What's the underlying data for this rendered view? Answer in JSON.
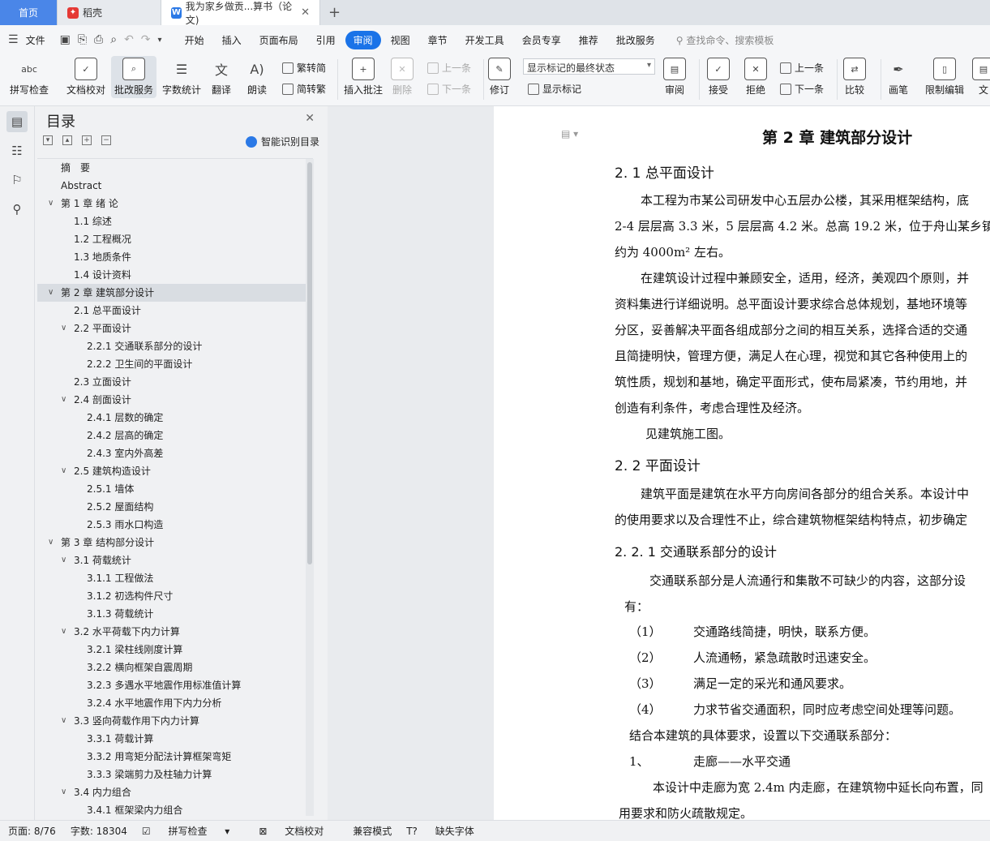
{
  "tabs": {
    "home": "首页",
    "daoke": "稻壳",
    "doc": "我为家乡做贡...算书（论文)",
    "add": "+"
  },
  "menu": {
    "file": "文件",
    "items": [
      "开始",
      "插入",
      "页面布局",
      "引用",
      "审阅",
      "视图",
      "章节",
      "开发工具",
      "会员专享",
      "推荐",
      "批改服务"
    ],
    "active": "审阅",
    "search": "查找命令、搜索模板"
  },
  "ribbon": {
    "spell": "拼写检查",
    "doccheck": "文档校对",
    "correct": "批改服务",
    "wordcount": "字数统计",
    "translate": "翻译",
    "read": "朗读",
    "trad": "繁转简",
    "simp": "简转繁",
    "insert_comment": "插入批注",
    "delete": "删除",
    "prev": "上一条",
    "next": "下一条",
    "track": "修订",
    "mark_state": "显示标记的最终状态",
    "show_marks": "显示标记",
    "review": "审阅",
    "accept": "接受",
    "reject": "拒绝",
    "prev2": "上一条",
    "next2": "下一条",
    "compare": "比较",
    "pen": "画笔",
    "restrict": "限制编辑",
    "doc_more": "文"
  },
  "toc": {
    "title": "目录",
    "smart": "智能识别目录",
    "items": [
      {
        "text": "摘　要",
        "level": 0,
        "chev": false
      },
      {
        "text": "Abstract",
        "level": 0,
        "chev": false
      },
      {
        "text": "第 1 章  绪  论",
        "level": 0,
        "chev": true
      },
      {
        "text": "1.1 综述",
        "level": 1,
        "chev": false
      },
      {
        "text": "1.2 工程概况",
        "level": 1,
        "chev": false
      },
      {
        "text": "1.3 地质条件",
        "level": 1,
        "chev": false
      },
      {
        "text": "1.4 设计资料",
        "level": 1,
        "chev": false
      },
      {
        "text": "第 2 章  建筑部分设计",
        "level": 0,
        "chev": true,
        "selected": true
      },
      {
        "text": "2.1 总平面设计",
        "level": 1,
        "chev": false
      },
      {
        "text": "2.2  平面设计",
        "level": 1,
        "chev": true
      },
      {
        "text": "2.2.1 交通联系部分的设计",
        "level": 2,
        "chev": false
      },
      {
        "text": "2.2.2 卫生间的平面设计",
        "level": 2,
        "chev": false
      },
      {
        "text": "2.3 立面设计",
        "level": 1,
        "chev": false
      },
      {
        "text": "2.4 剖面设计",
        "level": 1,
        "chev": true
      },
      {
        "text": "2.4.1 层数的确定",
        "level": 2,
        "chev": false
      },
      {
        "text": "2.4.2 层高的确定",
        "level": 2,
        "chev": false
      },
      {
        "text": "2.4.3 室内外高差",
        "level": 2,
        "chev": false
      },
      {
        "text": "2.5 建筑构造设计",
        "level": 1,
        "chev": true
      },
      {
        "text": "2.5.1 墙体",
        "level": 2,
        "chev": false
      },
      {
        "text": "2.5.2 屋面结构",
        "level": 2,
        "chev": false
      },
      {
        "text": "2.5.3 雨水口构造",
        "level": 2,
        "chev": false
      },
      {
        "text": "第 3 章  结构部分设计",
        "level": 0,
        "chev": true
      },
      {
        "text": "3.1 荷载统计",
        "level": 1,
        "chev": true
      },
      {
        "text": "3.1.1 工程做法",
        "level": 2,
        "chev": false
      },
      {
        "text": "3.1.2 初选构件尺寸",
        "level": 2,
        "chev": false
      },
      {
        "text": "3.1.3 荷载统计",
        "level": 2,
        "chev": false
      },
      {
        "text": "3.2 水平荷载下内力计算",
        "level": 1,
        "chev": true
      },
      {
        "text": "3.2.1  梁柱线刚度计算",
        "level": 2,
        "chev": false
      },
      {
        "text": "3.2.2  横向框架自震周期",
        "level": 2,
        "chev": false
      },
      {
        "text": "3.2.3  多遇水平地震作用标准值计算",
        "level": 2,
        "chev": false
      },
      {
        "text": "3.2.4 水平地震作用下内力分析",
        "level": 2,
        "chev": false
      },
      {
        "text": "3.3  竖向荷载作用下内力计算",
        "level": 1,
        "chev": true
      },
      {
        "text": "3.3.1  荷载计算",
        "level": 2,
        "chev": false
      },
      {
        "text": "3.3.2  用弯矩分配法计算框架弯矩",
        "level": 2,
        "chev": false
      },
      {
        "text": "3.3.3  梁端剪力及柱轴力计算",
        "level": 2,
        "chev": false
      },
      {
        "text": "3.4  内力组合",
        "level": 1,
        "chev": true
      },
      {
        "text": "3.4.1  框架梁内力组合",
        "level": 2,
        "chev": false
      }
    ]
  },
  "document": {
    "chapter_title": "第 2 章  建筑部分设计",
    "s21": "2. 1 总平面设计",
    "p1": [
      "本工程为市某公司研发中心五层办公楼，其采用框架结构，底",
      "2-4 层层高 3.3 米，5 层层高 4.2 米。总高 19.2 米，位于舟山某乡镇",
      "约为 4000m² 左右。"
    ],
    "p2": [
      "在建筑设计过程中兼顾安全，适用，经济，美观四个原则，并",
      "资料集进行详细说明。总平面设计要求综合总体规划，基地环境等",
      "分区，妥善解决平面各组成部分之间的相互关系，选择合适的交通",
      "且简捷明快，管理方便，满足人在心理，视觉和其它各种使用上的",
      "筑性质，规划和基地，确定平面形式，使布局紧凑，节约用地，并",
      "创造有利条件，考虑合理性及经济。"
    ],
    "p3": "见建筑施工图。",
    "s22": "2. 2  平面设计",
    "p4": [
      "建筑平面是建筑在水平方向房间各部分的组合关系。本设计中",
      "的使用要求以及合理性不止，综合建筑物框架结构特点，初步确定"
    ],
    "s221": "2. 2. 1 交通联系部分的设计",
    "p5": [
      "交通联系部分是人流通行和集散不可缺少的内容，这部分设",
      "有："
    ],
    "list": [
      {
        "num": "（1）",
        "text": "交通路线简捷，明快，联系方便。"
      },
      {
        "num": "（2）",
        "text": "人流通畅，紧急疏散时迅速安全。"
      },
      {
        "num": "（3）",
        "text": "满足一定的采光和通风要求。"
      },
      {
        "num": "（4）",
        "text": "力求节省交通面积，同时应考虑空间处理等问题。"
      }
    ],
    "p6": "结合本建筑的具体要求，设置以下交通联系部分：",
    "item1_num": "1、",
    "item1_text": "走廊——水平交通",
    "p7": [
      "本设计中走廊为宽 2.4m 内走廊，在建筑物中延长向布置，同",
      "用要求和防火疏散规定。"
    ]
  },
  "status": {
    "page": "页面: 8/76",
    "words": "字数: 18304",
    "spell": "拼写检查",
    "doccheck": "文档校对",
    "compat": "兼容模式",
    "missing_font": "缺失字体"
  }
}
